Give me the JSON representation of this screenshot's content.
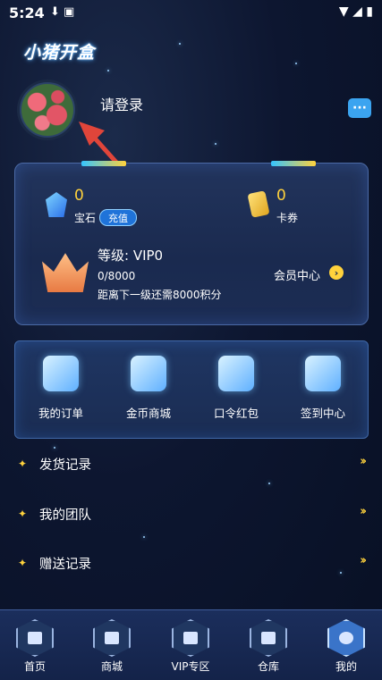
{
  "status_bar": {
    "time": "5:24",
    "left_icons": "⬇ ▣",
    "right_icons": "▼ ◢ ▮"
  },
  "app_title": "小猪开盒",
  "profile": {
    "login_text": "请登录",
    "message_icon": "chat-bubble-icon"
  },
  "vip_card": {
    "gems": {
      "value": "0",
      "label": "宝石",
      "recharge_label": "充值"
    },
    "coupons": {
      "value": "0",
      "label": "卡券"
    },
    "level_text": "等级: VIP0",
    "progress_text": "0/8000",
    "next_level_text": "距离下一级还需8000积分",
    "member_center_label": "会员中心"
  },
  "quick_actions": [
    {
      "label": "我的订单",
      "icon": "order-icon"
    },
    {
      "label": "金币商城",
      "icon": "coin-mall-icon"
    },
    {
      "label": "口令红包",
      "icon": "red-packet-icon"
    },
    {
      "label": "签到中心",
      "icon": "checkin-icon"
    }
  ],
  "menu_items": [
    {
      "label": "发货记录"
    },
    {
      "label": "我的团队"
    },
    {
      "label": "赠送记录"
    }
  ],
  "bottom_nav": [
    {
      "label": "首页",
      "icon": "home-icon"
    },
    {
      "label": "商城",
      "icon": "mall-icon"
    },
    {
      "label": "VIP专区",
      "icon": "vip-icon"
    },
    {
      "label": "仓库",
      "icon": "warehouse-icon"
    },
    {
      "label": "我的",
      "icon": "profile-icon",
      "active": true
    }
  ],
  "colors": {
    "accent": "#ffd23c",
    "primary_blue": "#1f73d9",
    "background": "#0d1630"
  }
}
